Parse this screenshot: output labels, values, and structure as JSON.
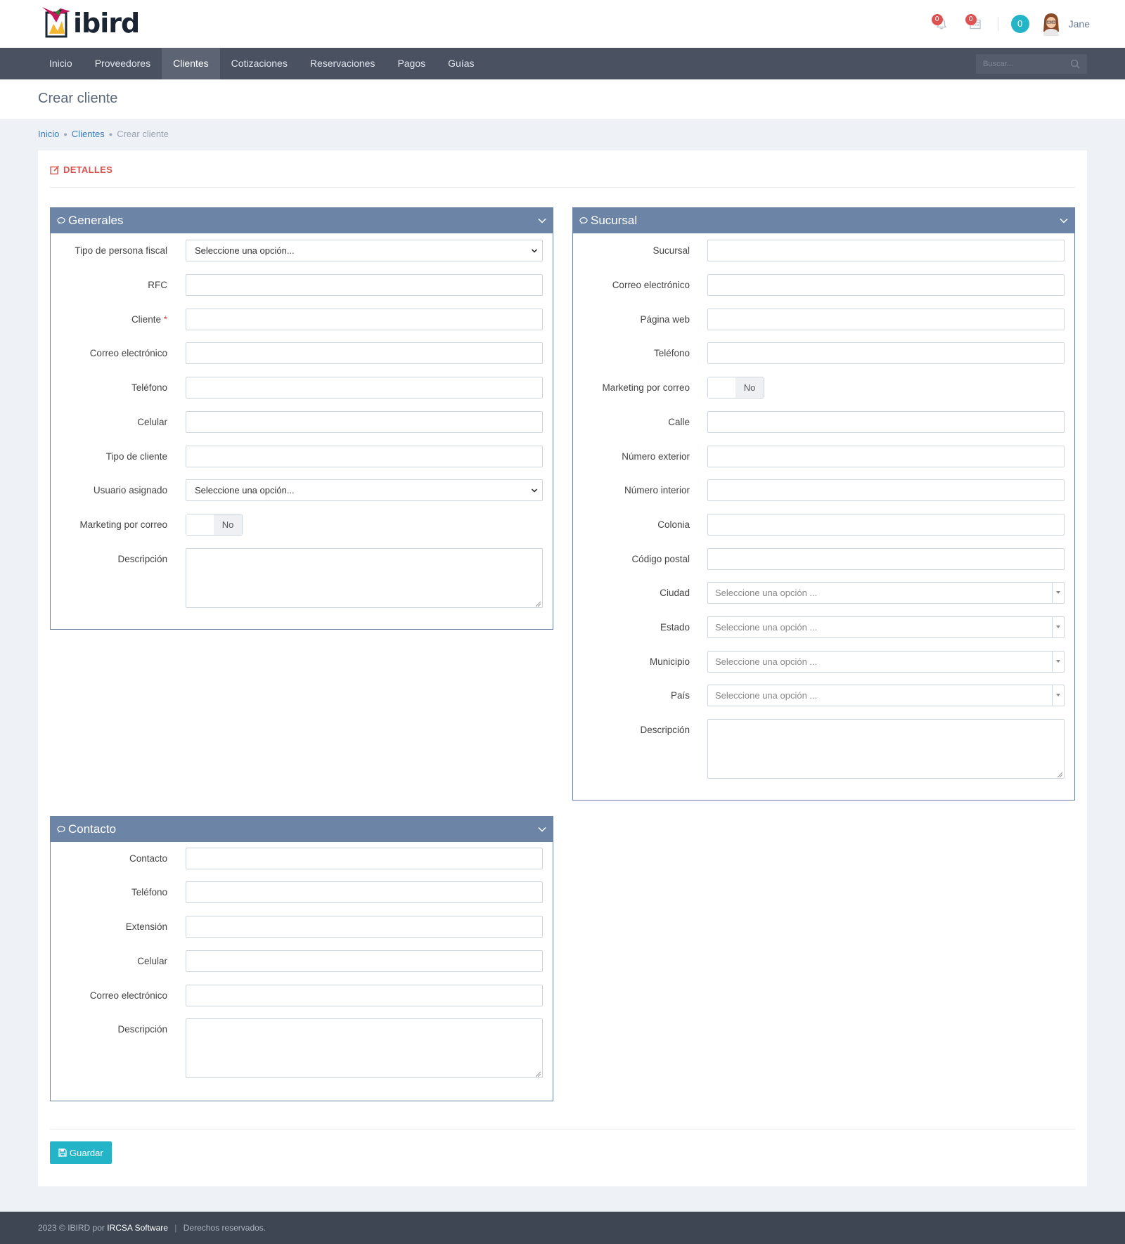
{
  "header": {
    "logo_text": "ibird",
    "notifications_count": "0",
    "calendar_count": "0",
    "chat_count": "0",
    "username": "Jane"
  },
  "nav": {
    "items": [
      {
        "label": "Inicio"
      },
      {
        "label": "Proveedores"
      },
      {
        "label": "Clientes",
        "active": true
      },
      {
        "label": "Cotizaciones"
      },
      {
        "label": "Reservaciones"
      },
      {
        "label": "Pagos"
      },
      {
        "label": "Guías"
      }
    ],
    "search_placeholder": "Buscar..."
  },
  "page": {
    "title": "Crear cliente",
    "breadcrumb": [
      "Inicio",
      "Clientes",
      "Crear cliente"
    ],
    "section_title": "DETALLES"
  },
  "generales": {
    "title": "Generales",
    "tipo_persona_label": "Tipo de persona fiscal",
    "tipo_persona_value": "Seleccione una opción...",
    "rfc_label": "RFC",
    "cliente_label": "Cliente",
    "cliente_required": "*",
    "correo_label": "Correo electrónico",
    "telefono_label": "Teléfono",
    "celular_label": "Celular",
    "tipo_cliente_label": "Tipo de cliente",
    "usuario_label": "Usuario asignado",
    "usuario_value": "Seleccione una opción...",
    "marketing_label": "Marketing por correo",
    "marketing_value": "No",
    "descripcion_label": "Descripción"
  },
  "sucursal": {
    "title": "Sucursal",
    "sucursal_label": "Sucursal",
    "correo_label": "Correo electrónico",
    "web_label": "Página web",
    "telefono_label": "Teléfono",
    "marketing_label": "Marketing por correo",
    "marketing_value": "No",
    "calle_label": "Calle",
    "num_ext_label": "Número exterior",
    "num_int_label": "Número interior",
    "colonia_label": "Colonia",
    "cp_label": "Código postal",
    "ciudad_label": "Ciudad",
    "ciudad_value": "Seleccione una opción ...",
    "estado_label": "Estado",
    "estado_value": "Seleccione una opción ...",
    "municipio_label": "Municipio",
    "municipio_value": "Seleccione una opción ...",
    "pais_label": "País",
    "pais_value": "Seleccione una opción ...",
    "descripcion_label": "Descripción"
  },
  "contacto": {
    "title": "Contacto",
    "contacto_label": "Contacto",
    "telefono_label": "Teléfono",
    "extension_label": "Extensión",
    "celular_label": "Celular",
    "correo_label": "Correo electrónico",
    "descripcion_label": "Descripción"
  },
  "actions": {
    "save_label": "Guardar"
  },
  "footer": {
    "prefix": "2023 © IBIRD por",
    "brand": "IRCSA Software",
    "separator": "|",
    "rights": "Derechos reservados."
  },
  "colors": {
    "navbar": "#4a5262",
    "panel_header": "#6c84a5",
    "accent": "#24b4c7",
    "danger": "#d9534f",
    "badge": "#e05252"
  }
}
